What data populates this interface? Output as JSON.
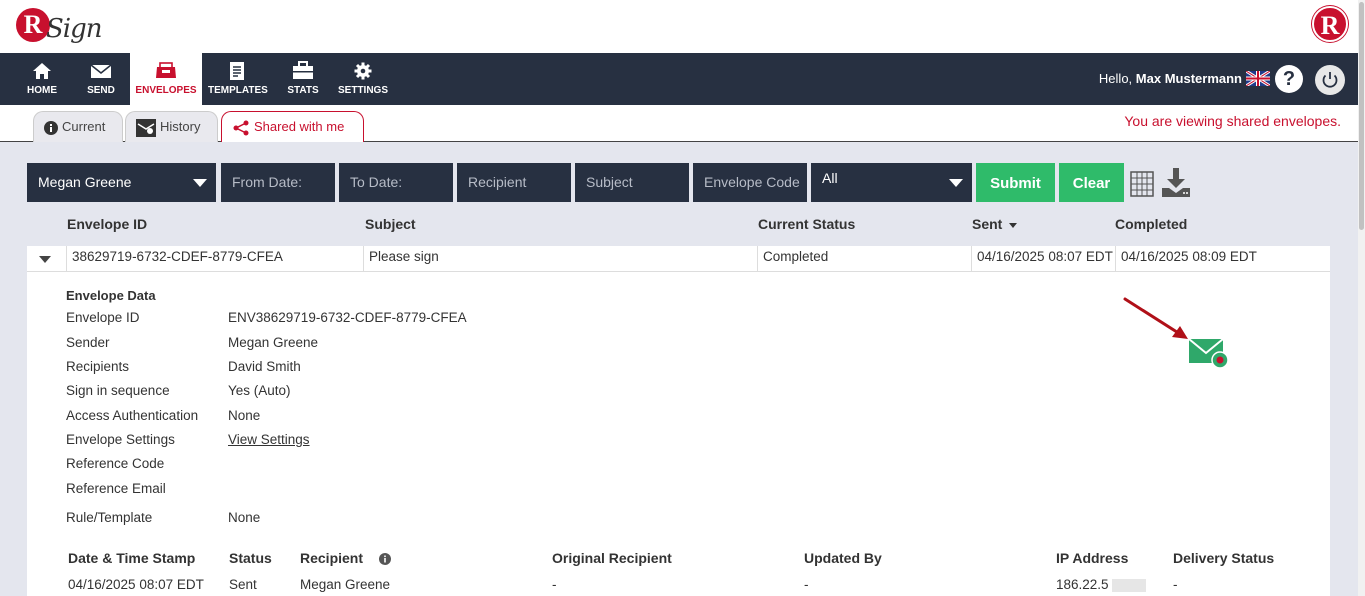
{
  "brand": {
    "logo_letter": "R",
    "logo_text": "Sign",
    "right_logo_letter": "R"
  },
  "nav": {
    "items": [
      {
        "label": "HOME"
      },
      {
        "label": "SEND"
      },
      {
        "label": "ENVELOPES"
      },
      {
        "label": "TEMPLATES"
      },
      {
        "label": "STATS"
      },
      {
        "label": "SETTINGS"
      }
    ],
    "greeting": "Hello,",
    "user_name": "Max Mustermann",
    "help_symbol": "?"
  },
  "tabs": [
    {
      "label": "Current"
    },
    {
      "label": "History"
    },
    {
      "label": "Shared with me"
    }
  ],
  "notice": "You are viewing shared envelopes.",
  "filters": {
    "sender_value": "Megan Greene",
    "from_date_placeholder": "From Date:",
    "to_date_placeholder": "To Date:",
    "recipient_placeholder": "Recipient",
    "subject_placeholder": "Subject",
    "envelope_code_placeholder": "Envelope Code",
    "status_value": "All",
    "submit_label": "Submit",
    "clear_label": "Clear"
  },
  "columns": {
    "envelope_id": "Envelope ID",
    "subject": "Subject",
    "current_status": "Current Status",
    "sent": "Sent",
    "completed": "Completed"
  },
  "row": {
    "envelope_id": "38629719-6732-CDEF-8779-CFEA",
    "subject": "Please sign",
    "status": "Completed",
    "sent": "04/16/2025 08:07 EDT",
    "completed": "04/16/2025 08:09 EDT"
  },
  "details": {
    "heading": "Envelope Data",
    "fields": [
      {
        "label": "Envelope ID",
        "value": "ENV38629719-6732-CDEF-8779-CFEA"
      },
      {
        "label": "Sender",
        "value": "Megan Greene"
      },
      {
        "label": "Recipients",
        "value": "David Smith"
      },
      {
        "label": "Sign in sequence",
        "value": "Yes (Auto)"
      },
      {
        "label": "Access Authentication",
        "value": "None"
      },
      {
        "label": "Envelope Settings",
        "value": "View Settings"
      },
      {
        "label": "Reference Code",
        "value": ""
      },
      {
        "label": "Reference Email",
        "value": ""
      },
      {
        "label": "Rule/Template",
        "value": "None"
      }
    ]
  },
  "history": {
    "headers": [
      "Date & Time Stamp",
      "Status",
      "Recipient",
      "Original Recipient",
      "Updated By",
      "IP Address",
      "Delivery Status"
    ],
    "rows": [
      {
        "timestamp": "04/16/2025 08:07 EDT",
        "status": "Sent",
        "recipient": "Megan Greene",
        "original": "-",
        "updated_by": "-",
        "ip": "186.22.5",
        "delivery": "-"
      }
    ]
  },
  "colors": {
    "brand_red": "#c8102e",
    "nav_bg": "#273041",
    "green": "#2fbb6a",
    "content_bg": "#e4e6ee"
  }
}
